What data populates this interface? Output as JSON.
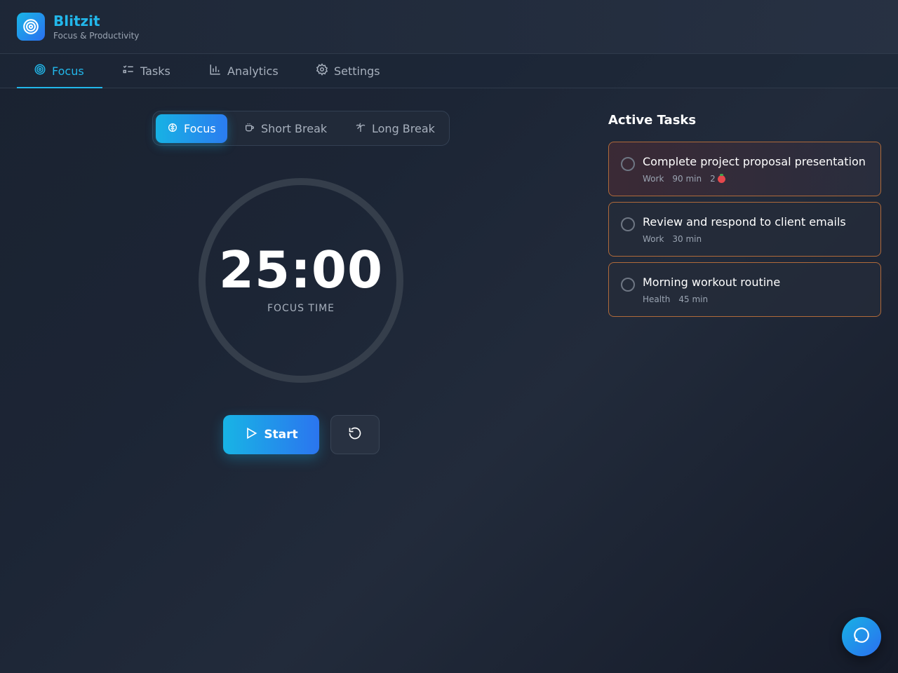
{
  "app": {
    "title": "Blitzit",
    "subtitle": "Focus & Productivity",
    "logo_icon": "target-icon"
  },
  "nav": {
    "tabs": [
      {
        "label": "Focus",
        "icon": "target-icon",
        "active": true
      },
      {
        "label": "Tasks",
        "icon": "list-checks-icon",
        "active": false
      },
      {
        "label": "Analytics",
        "icon": "bar-chart-icon",
        "active": false
      },
      {
        "label": "Settings",
        "icon": "gear-icon",
        "active": false
      }
    ]
  },
  "modes": [
    {
      "label": "Focus",
      "icon": "brain-icon",
      "active": true
    },
    {
      "label": "Short Break",
      "icon": "coffee-icon",
      "active": false
    },
    {
      "label": "Long Break",
      "icon": "palm-tree-icon",
      "active": false
    }
  ],
  "timer": {
    "time": "25:00",
    "label": "FOCUS TIME"
  },
  "controls": {
    "start_label": "Start",
    "start_icon": "play-icon",
    "reset_icon": "rotate-ccw-icon"
  },
  "tasks": {
    "title": "Active Tasks",
    "items": [
      {
        "title": "Complete project proposal presentation",
        "category": "Work",
        "duration": "90 min",
        "pomodoros": "2"
      },
      {
        "title": "Review and respond to client emails",
        "category": "Work",
        "duration": "30 min"
      },
      {
        "title": "Morning workout routine",
        "category": "Health",
        "duration": "45 min"
      }
    ]
  },
  "chat": {
    "icon": "chat-bubble-icon"
  },
  "colors": {
    "accent": "#22b7ea",
    "accent_blue": "#2b6ff0",
    "task_border": "#b06a3a",
    "tomato": "#e5484d"
  }
}
